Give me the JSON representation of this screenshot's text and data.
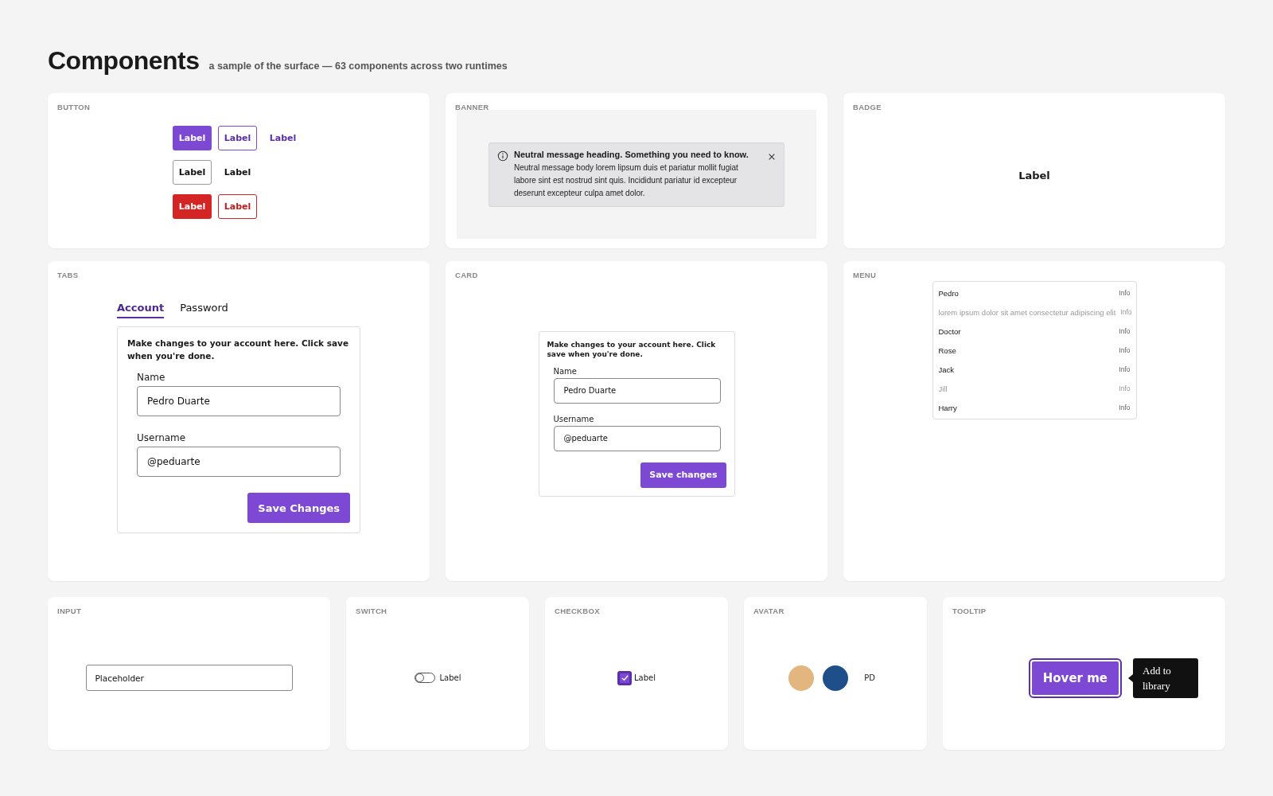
{
  "title": "Components",
  "subtitle": "a sample of the surface — 63 components across two runtimes",
  "button": {
    "heading": "BUTTON",
    "rows": [
      [
        {
          "label": "Label",
          "kind": "primary"
        },
        {
          "label": "Label",
          "kind": "outline"
        },
        {
          "label": "Label",
          "kind": "ghost"
        }
      ],
      [
        {
          "label": "Label",
          "kind": "secondary"
        },
        {
          "label": "Label",
          "kind": "plain"
        }
      ],
      [
        {
          "label": "Label",
          "kind": "danger"
        },
        {
          "label": "Label",
          "kind": "danger-outline"
        }
      ]
    ]
  },
  "banner": {
    "heading": "BANNER",
    "title": "Neutral message heading. Something you need to know.",
    "body": "Neutral message body lorem lipsum duis et pariatur mollit fugiat labore sint est nostrud sint quis. Incididunt pariatur id excepteur deserunt excepteur culpa amet dolor."
  },
  "badge": {
    "heading": "BADGE",
    "label": "Label"
  },
  "tabs": {
    "heading": "TABS",
    "items": [
      {
        "label": "Account",
        "selected": true
      },
      {
        "label": "Password",
        "selected": false
      }
    ],
    "description": "Make changes to your account here. Click save when you're done.",
    "fields": [
      {
        "label": "Name",
        "value": "Pedro Duarte"
      },
      {
        "label": "Username",
        "value": "@peduarte"
      }
    ],
    "button": "Save Changes"
  },
  "card": {
    "heading": "CARD",
    "description": "Make changes to your account here. Click save when you're done.",
    "fields": [
      {
        "label": "Name",
        "value": "Pedro Duarte"
      },
      {
        "label": "Username",
        "value": "@peduarte"
      }
    ],
    "button": "Save changes"
  },
  "menu": {
    "heading": "MENU",
    "items": [
      {
        "label": "Pedro",
        "info": "Info",
        "disabled": false
      },
      {
        "label": "lorem ipsum dolor sit amet consectetur adipiscing elit",
        "info": "Info",
        "disabled": true
      },
      {
        "label": "Doctor",
        "info": "Info",
        "disabled": false
      },
      {
        "label": "Rose",
        "info": "Info",
        "disabled": false
      },
      {
        "label": "Jack",
        "info": "Info",
        "disabled": false
      },
      {
        "label": "Jill",
        "info": "Info",
        "disabled": true
      },
      {
        "label": "Harry",
        "info": "Info",
        "disabled": false
      }
    ]
  },
  "input": {
    "heading": "INPUT",
    "placeholder": "Placeholder"
  },
  "switch": {
    "heading": "SWITCH",
    "label": "Label",
    "on": false
  },
  "checkbox": {
    "heading": "CHECKBOX",
    "label": "Label",
    "checked": true
  },
  "avatar": {
    "heading": "AVATAR",
    "items": [
      {
        "kind": "photo"
      },
      {
        "kind": "photo"
      },
      {
        "kind": "initials",
        "text": "PD"
      }
    ]
  },
  "tooltip": {
    "heading": "TOOLTIP",
    "button": "Hover me",
    "tip": "Add to library"
  }
}
